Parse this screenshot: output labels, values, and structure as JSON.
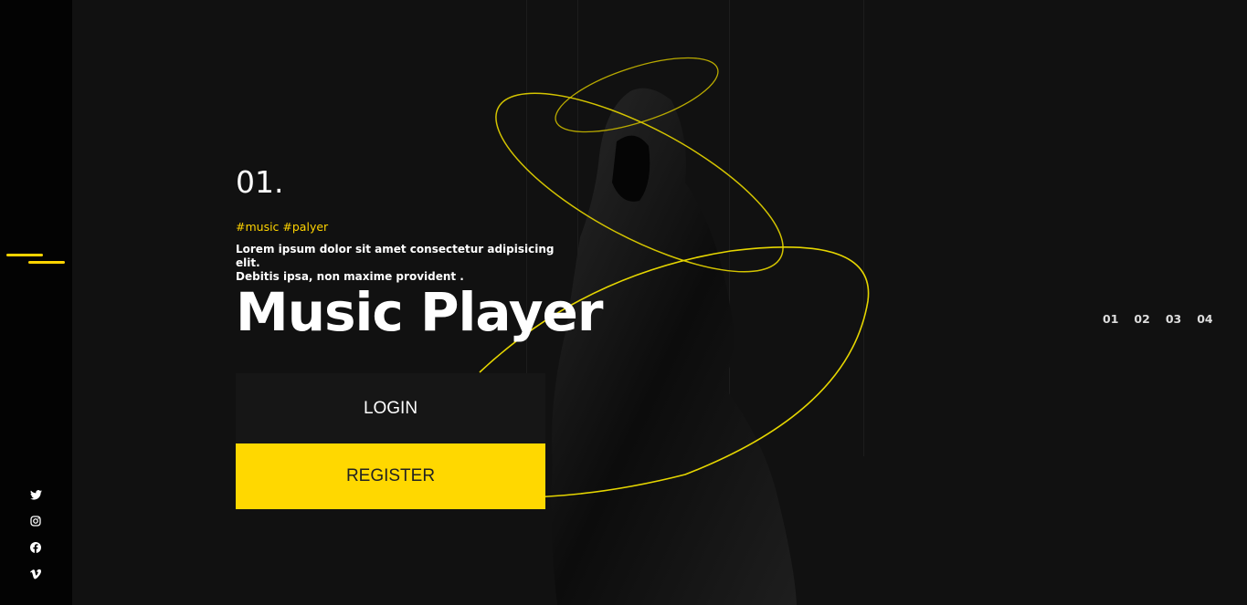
{
  "slide_number": "01.",
  "tags": "#music #palyer",
  "description_line1": "Lorem ipsum dolor sit amet consectetur adipisicing elit.",
  "description_line2": "Debitis ipsa, non maxime provident .",
  "title": "Music Player",
  "buttons": {
    "login": "LOGIN",
    "register": "REGISTER"
  },
  "pagination": [
    "01",
    "02",
    "03",
    "04"
  ],
  "social": [
    "twitter-icon",
    "instagram-icon",
    "facebook-icon",
    "vimeo-icon"
  ],
  "colors": {
    "accent": "#ffd800",
    "background": "#111111",
    "sidebar": "#030303"
  }
}
